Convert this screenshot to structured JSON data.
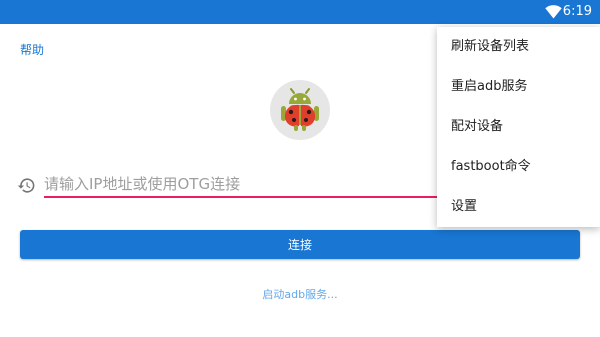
{
  "status_bar": {
    "time": "6:19",
    "icon": "wifi-icon"
  },
  "help_link": "帮助",
  "logo": {
    "icon": "ladybug-android-icon"
  },
  "ip_input": {
    "placeholder": "请输入IP地址或使用OTG连接",
    "value": "",
    "history_icon": "history-icon"
  },
  "connect_button": "连接",
  "start_adb_link": "启动adb服务...",
  "overflow_menu": {
    "items": [
      {
        "label": "刷新设备列表"
      },
      {
        "label": "重启adb服务"
      },
      {
        "label": "配对设备"
      },
      {
        "label": "fastboot命令"
      },
      {
        "label": "设置"
      }
    ]
  },
  "colors": {
    "primary": "#1976d2",
    "accent": "#e91e63",
    "link_light": "#64a8e8"
  }
}
